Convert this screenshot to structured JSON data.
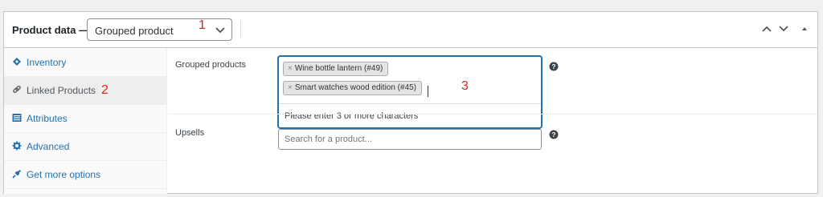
{
  "header": {
    "title": "Product data —",
    "product_type": "Grouped product",
    "buttons": [
      "chevron-up-icon",
      "chevron-down-icon",
      "triangle-up-icon"
    ]
  },
  "annotations": [
    "1",
    "2",
    "3"
  ],
  "tabs": [
    {
      "label": "Inventory",
      "icon": "inventory-icon",
      "active": false
    },
    {
      "label": "Linked Products",
      "icon": "link-icon",
      "active": true
    },
    {
      "label": "Attributes",
      "icon": "attributes-icon",
      "active": false
    },
    {
      "label": "Advanced",
      "icon": "gear-icon",
      "active": false
    },
    {
      "label": "Get more options",
      "icon": "plugin-icon",
      "active": false
    }
  ],
  "grouped": {
    "label": "Grouped products",
    "selected": [
      "Wine bottle lantern (#49)",
      "Smart watches wood edition (#45)"
    ],
    "remove_glyph": "×",
    "message": "Please enter 3 or more characters"
  },
  "upsells": {
    "label": "Upsells",
    "placeholder": "Search for a product..."
  },
  "colors": {
    "accent": "#2271b1",
    "annotation": "#e02020"
  }
}
